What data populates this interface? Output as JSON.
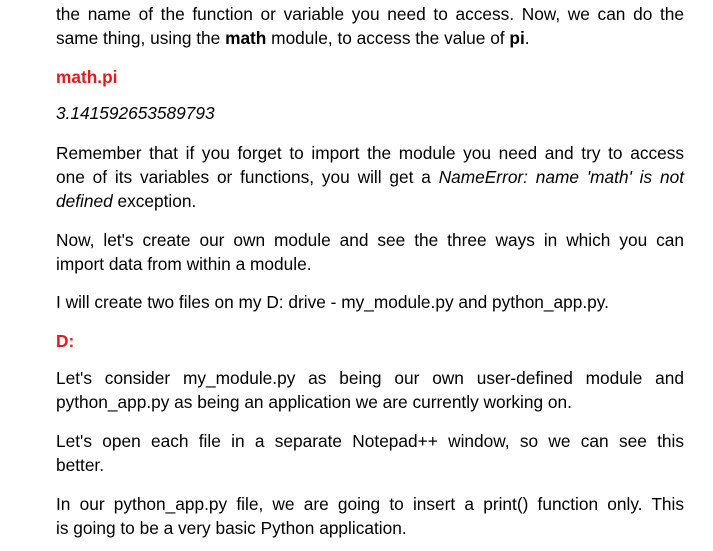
{
  "p1": {
    "line1": {
      "text": "the name of the function or variable you need to access. Now, we can do the"
    },
    "line2": {
      "before": "same thing, using the ",
      "bold1": "math",
      "middle": " module, to access the value of ",
      "bold2": "pi",
      "after": "."
    }
  },
  "code1": "math.pi",
  "output1": "3.141592653589793",
  "p2": {
    "line1": "Remember that if you forget to import the module you need and try to access",
    "line2_before": "one of its variables or functions, you will get a ",
    "line2_italic": "NameError: name 'math' is not",
    "line3_italic": "defined",
    "line3_after": " exception."
  },
  "p3": {
    "line1": "Now, let's create our own module and see the three ways in which you can",
    "line2": "import data from within a module."
  },
  "p4": "I will create two files on my D: drive - my_module.py and python_app.py.",
  "code2": "D:",
  "p5": {
    "line1": "Let's consider my_module.py as being our own user-defined module and",
    "line2": "python_app.py as being an application we are currently working on."
  },
  "p6": {
    "line1": "Let's open each file in a separate Notepad++ window, so we can see this",
    "line2": "better."
  },
  "p7": {
    "line1": "In our python_app.py file, we are going to insert a print() function only. This",
    "line2": "is going to be a very basic Python application."
  },
  "colors": {
    "code": "#e8191c",
    "text": "#000000",
    "background": "#ffffff"
  }
}
